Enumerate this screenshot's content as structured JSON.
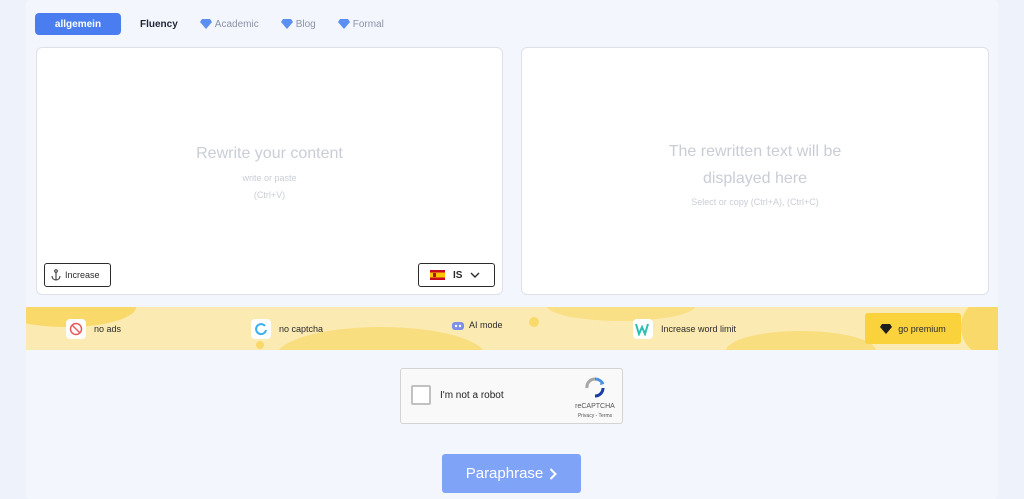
{
  "modes": {
    "active": "allgemein",
    "fluency": "Fluency",
    "academic": "Academic",
    "blog": "Blog",
    "formal": "Formal"
  },
  "input_box": {
    "title": "Rewrite your content",
    "hint": "write or paste",
    "shortcut": "(Ctrl+V)",
    "increase_label": "Increase",
    "language": "IS"
  },
  "output_box": {
    "title_line1": "The rewritten text will be",
    "title_line2": "displayed here",
    "hint": "Select or copy (Ctrl+A), (Ctrl+C)"
  },
  "banner": {
    "features": [
      {
        "label": "no ads",
        "icon": "no-ads-icon"
      },
      {
        "label": "no captcha",
        "icon": "captcha-icon"
      },
      {
        "label": "AI mode",
        "icon": "robot-icon"
      },
      {
        "label": "Increase word limit",
        "icon": "word-limit-icon"
      }
    ],
    "premium_label": "go premium"
  },
  "captcha": {
    "label": "I'm not a robot",
    "brand": "reCAPTCHA",
    "links": "Privacy - Terms"
  },
  "submit": {
    "label": "Paraphrase"
  },
  "colors": {
    "accent": "#4a7ef0",
    "button": "#7fa3f6",
    "banner": "#fbeab2",
    "premium": "#f9d23c"
  }
}
